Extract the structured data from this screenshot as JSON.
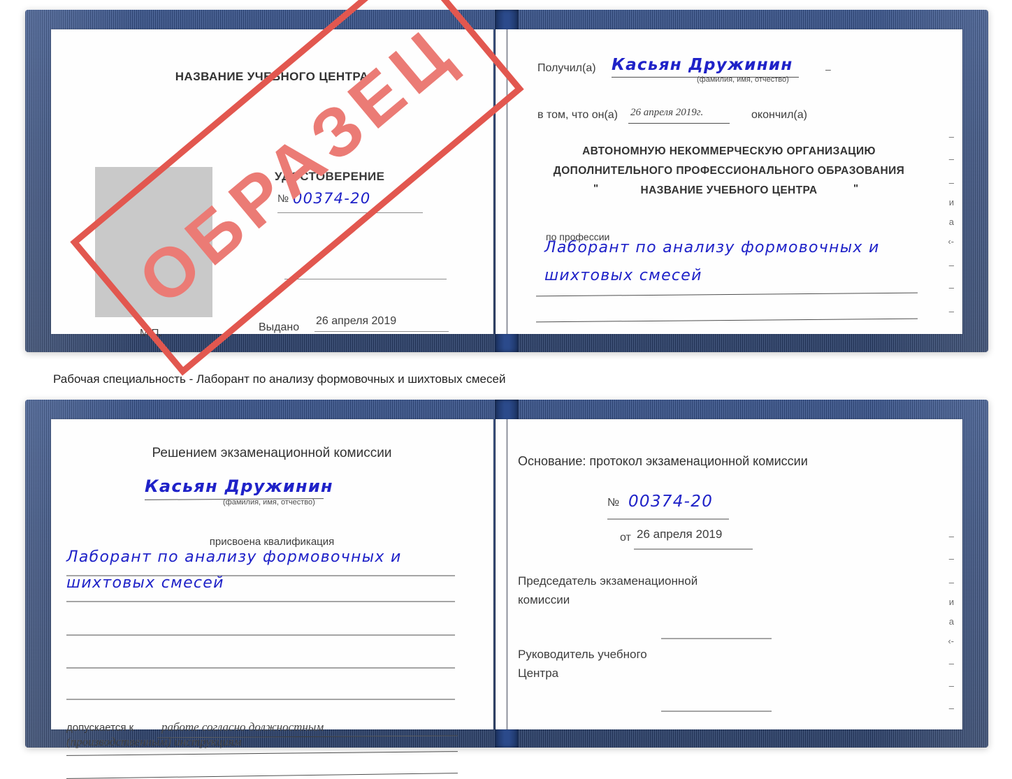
{
  "caption": "Рабочая специальность - Лаборант по анализу формовочных и шихтовых смесей",
  "watermark": {
    "text": "ОБРАЗЕЦ",
    "color": "#e2574f"
  },
  "colors": {
    "cover_blue": "#23407c",
    "handwriting_blue": "#1f22c8",
    "stamp_red": "#e2574f",
    "photo_gray": "#c9c9c9",
    "rule_gray": "#8e8e8e"
  },
  "certificate_top": {
    "left_page": {
      "center_name": "НАЗВАНИЕ УЧЕБНОГО ЦЕНТРА",
      "doc_title": "УДОСТОВЕРЕНИЕ",
      "number_symbol": "№",
      "number_value": "00374-20",
      "issued_label": "Выдано",
      "issued_value": "26 апреля 2019",
      "seal_label": "М.П.",
      "photo_placeholder": "photo-placeholder"
    },
    "right_page": {
      "received_label": "Получил(а)",
      "received_value": "Касьян Дружинин",
      "name_hint": "(фамилия, имя, отчество)",
      "in_that_label": "в том, что он(а)",
      "in_that_value": "26 апреля 2019г.",
      "graduated_label": "окончил(а)",
      "org_line1": "АВТОНОМНУЮ НЕКОММЕРЧЕСКУЮ ОРГАНИЗАЦИЮ",
      "org_line2": "ДОПОЛНИТЕЛЬНОГО ПРОФЕССИОНАЛЬНОГО ОБРАЗОВАНИЯ",
      "org_quote_open": "\"",
      "org_name": "НАЗВАНИЕ УЧЕБНОГО ЦЕНТРА",
      "org_quote_close": "\"",
      "profession_label": "по профессии",
      "profession_line1": "Лаборант по анализу формовочных и",
      "profession_line2": "шихтовых смесей",
      "edge_marks": [
        "–",
        "–",
        "–",
        "и",
        "а",
        "‹-",
        "–",
        "–",
        "–"
      ]
    }
  },
  "certificate_bottom": {
    "left_page": {
      "decision_title": "Решением экзаменационной комиссии",
      "name_value": "Касьян Дружинин",
      "name_hint": "(фамилия, имя, отчество)",
      "qualification_label": "присвоена квалификация",
      "qualification_line1": "Лаборант по анализу формовочных и",
      "qualification_line2": "шихтовых смесей",
      "admitted_label": "допускается к",
      "admitted_line1": "работе согласно должностным",
      "admitted_line2": "(производственным) инструкциям"
    },
    "right_page": {
      "basis_label": "Основание: протокол экзаменационной комиссии",
      "number_symbol": "№",
      "number_value": "00374-20",
      "from_label": "от",
      "from_value": "26 апреля 2019",
      "chairman_line1": "Председатель экзаменационной",
      "chairman_line2": "комиссии",
      "head_line1": "Руководитель учебного",
      "head_line2": "Центра",
      "edge_marks": [
        "–",
        "–",
        "–",
        "и",
        "а",
        "‹-",
        "–",
        "–",
        "–"
      ]
    }
  }
}
